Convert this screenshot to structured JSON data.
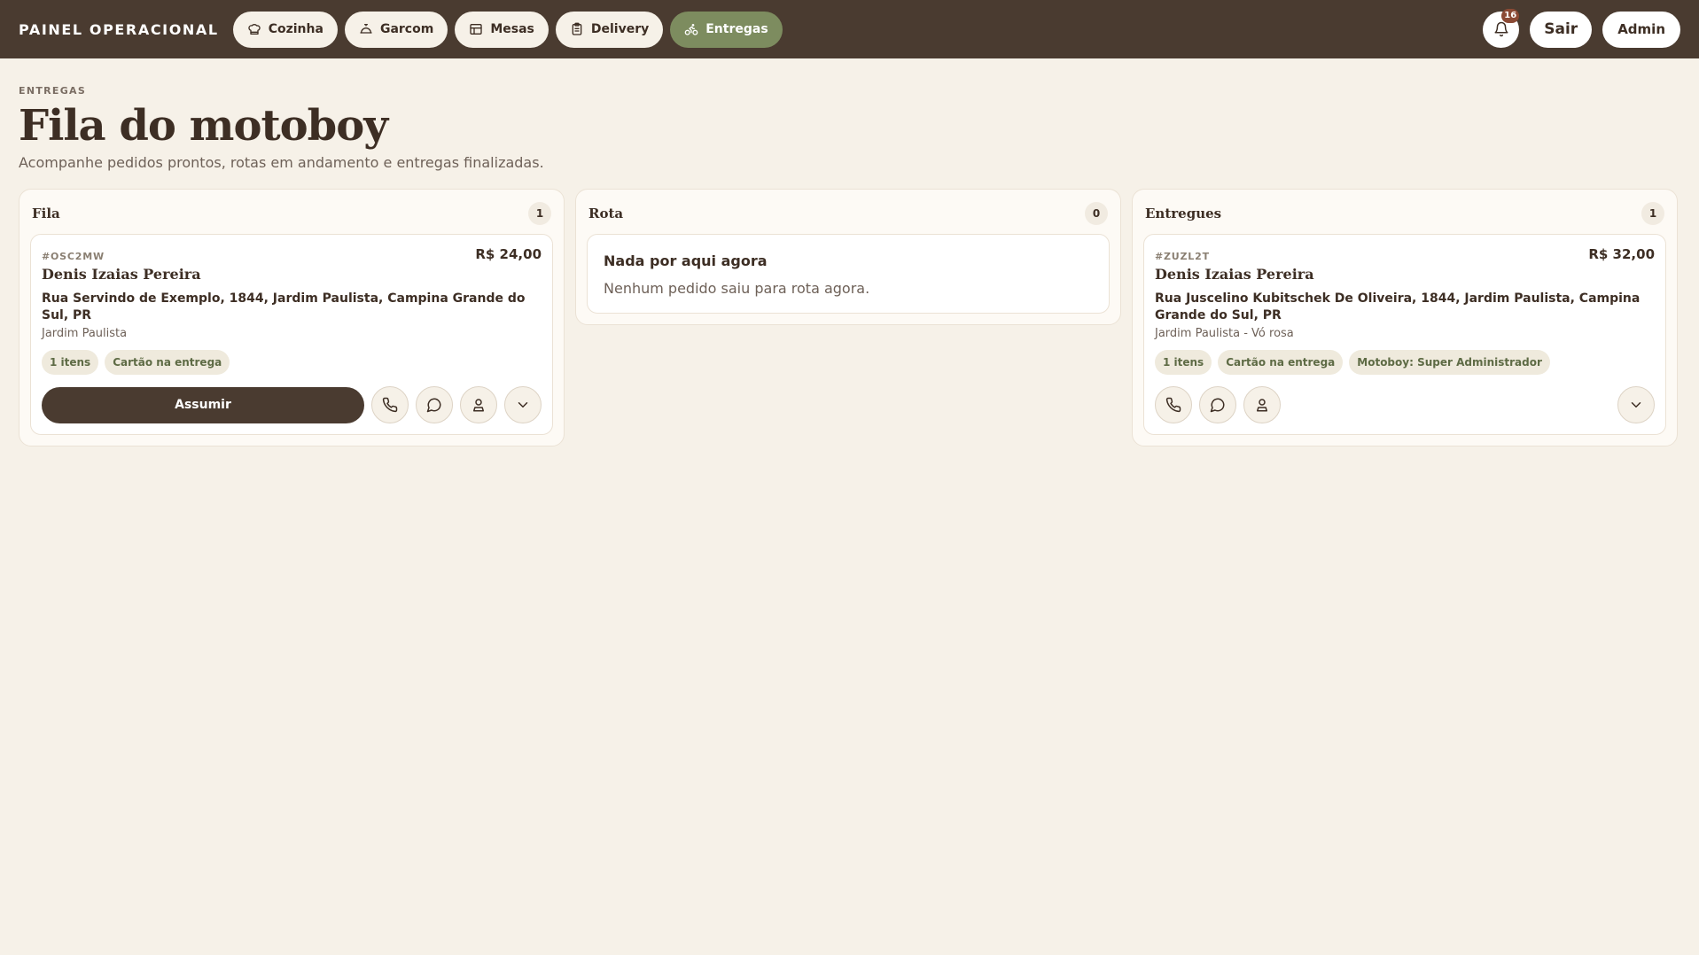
{
  "topbar": {
    "brand": "PAINEL OPERACIONAL",
    "nav": [
      {
        "label": "Cozinha",
        "icon": "chef-hat-icon",
        "active": false
      },
      {
        "label": "Garcom",
        "icon": "cloche-icon",
        "active": false
      },
      {
        "label": "Mesas",
        "icon": "table-icon",
        "active": false
      },
      {
        "label": "Delivery",
        "icon": "clipboard-icon",
        "active": false
      },
      {
        "label": "Entregas",
        "icon": "bike-icon",
        "active": true
      }
    ],
    "notifications_count": "16",
    "logout_label": "Sair",
    "user_label": "Admin"
  },
  "header": {
    "eyebrow": "ENTREGAS",
    "title": "Fila do motoboy",
    "subtitle": "Acompanhe pedidos prontos, rotas em andamento e entregas finalizadas."
  },
  "columns": {
    "fila": {
      "title": "Fila",
      "count": "1",
      "card": {
        "code": "#OSC2MW",
        "price": "R$ 24,00",
        "customer": "Denis Izaias Pereira",
        "address": "Rua Servindo de Exemplo, 1844, Jardim Paulista, Campina Grande do Sul, PR",
        "neighborhood": "Jardim Paulista",
        "tags": [
          "1 itens",
          "Cartão na entrega"
        ],
        "assign_label": "Assumir"
      }
    },
    "rota": {
      "title": "Rota",
      "count": "0",
      "empty_title": "Nada por aqui agora",
      "empty_sub": "Nenhum pedido saiu para rota agora."
    },
    "entregues": {
      "title": "Entregues",
      "count": "1",
      "card": {
        "code": "#ZUZL2T",
        "price": "R$ 32,00",
        "customer": "Denis Izaias Pereira",
        "address": "Rua Juscelino Kubitschek De Oliveira, 1844, Jardim Paulista, Campina Grande do Sul, PR",
        "neighborhood": "Jardim Paulista - Vó rosa",
        "tags": [
          "1 itens",
          "Cartão na entrega",
          "Motoboy: Super Administrador"
        ]
      }
    }
  },
  "colors": {
    "topbar": "#4a3b30",
    "background": "#f6f1e8",
    "active_pill": "#7d8c5f",
    "badge": "#8b4a35"
  }
}
